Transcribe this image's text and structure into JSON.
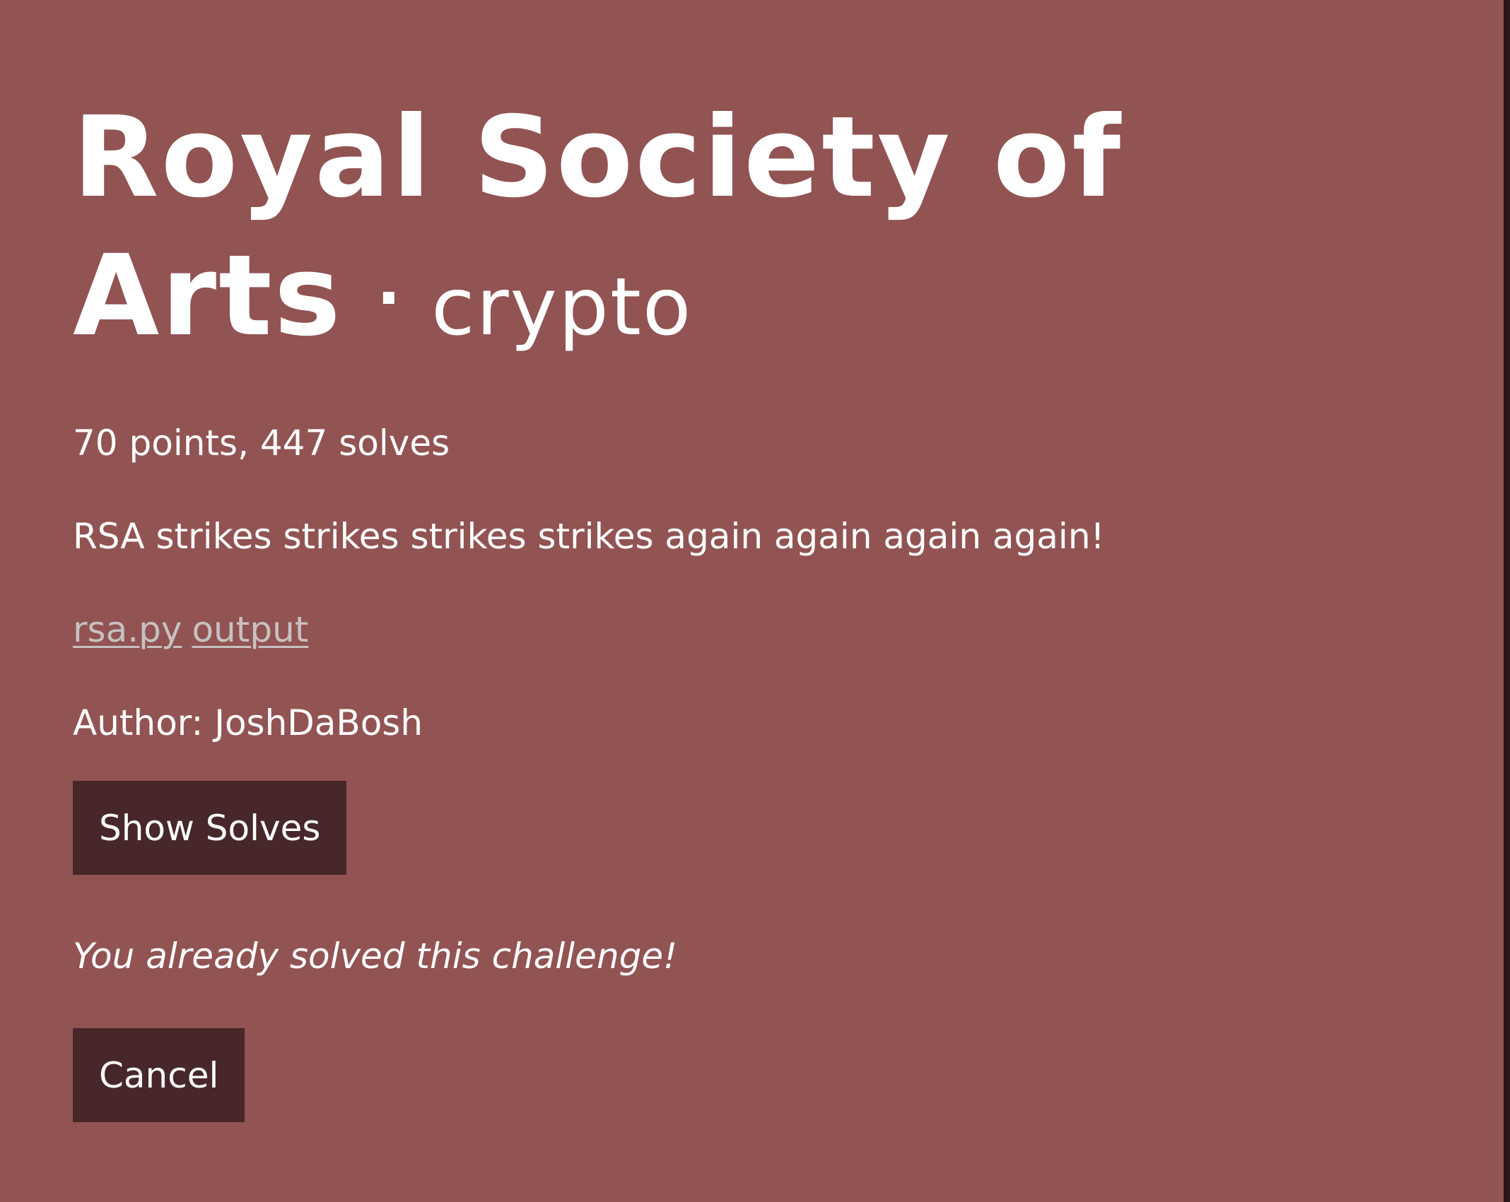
{
  "colors": {
    "background": "#925353",
    "button": "#472729",
    "link": "#c7c1c1",
    "text": "#ffffff"
  },
  "challenge": {
    "title": "Royal Society of Arts",
    "separator": "·",
    "category": "crypto",
    "meta": "70 points, 447 solves",
    "description": "RSA strikes strikes strikes strikes again again again again!",
    "files": [
      {
        "label": "rsa.py"
      },
      {
        "label": "output"
      }
    ],
    "author": "Author: JoshDaBosh",
    "solved_message": "You already solved this challenge!"
  },
  "buttons": {
    "show_solves": "Show Solves",
    "cancel": "Cancel"
  }
}
